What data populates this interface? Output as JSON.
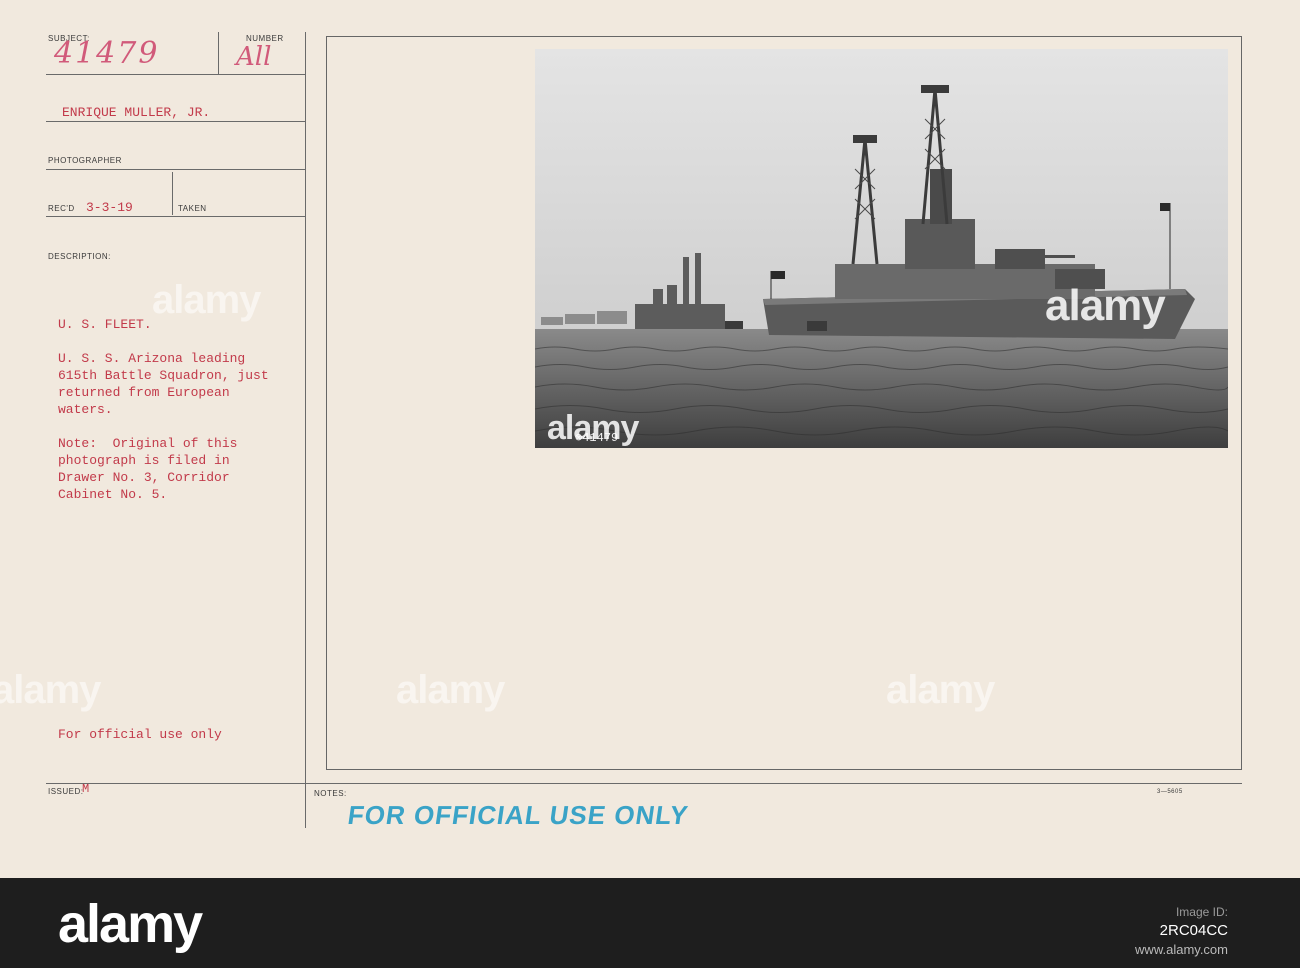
{
  "card": {
    "labels": {
      "subject": "SUBJECT:",
      "number": "NUMBER",
      "photographer": "PHOTOGRAPHER",
      "recd": "REC'D",
      "taken": "TAKEN",
      "description": "DESCRIPTION:",
      "issued": "ISSUED:",
      "notes": "NOTES:"
    },
    "subject_value": "41479",
    "number_value": "All",
    "photographer_name": "ENRIQUE MULLER, JR.",
    "recd_value": "3-3-19",
    "description_lines": [
      "U. S. FLEET.",
      "",
      "U. S. S. Arizona leading",
      "615th Battle Squadron, just",
      "returned from European",
      "waters.",
      "",
      "Note:  Original of this",
      "photograph is filed in",
      "Drawer No. 3, Corridor",
      "Cabinet No. 5."
    ],
    "official_use": "For official use only",
    "issued_value": "M",
    "form_number": "3—5605",
    "stamp": "FOR OFFICIAL USE ONLY",
    "photo_caption": "⊗41479"
  },
  "watermark": "alamy",
  "footer": {
    "logo": "alamy",
    "image_id_label": "Image ID:",
    "image_id": "2RC04CC",
    "site": "www.alamy.com"
  },
  "colors": {
    "card_bg": "#f1e9de",
    "typed_red": "#c23a4a",
    "stamp_blue": "#3aa3c7",
    "footer_bg": "#1e1e1e"
  }
}
